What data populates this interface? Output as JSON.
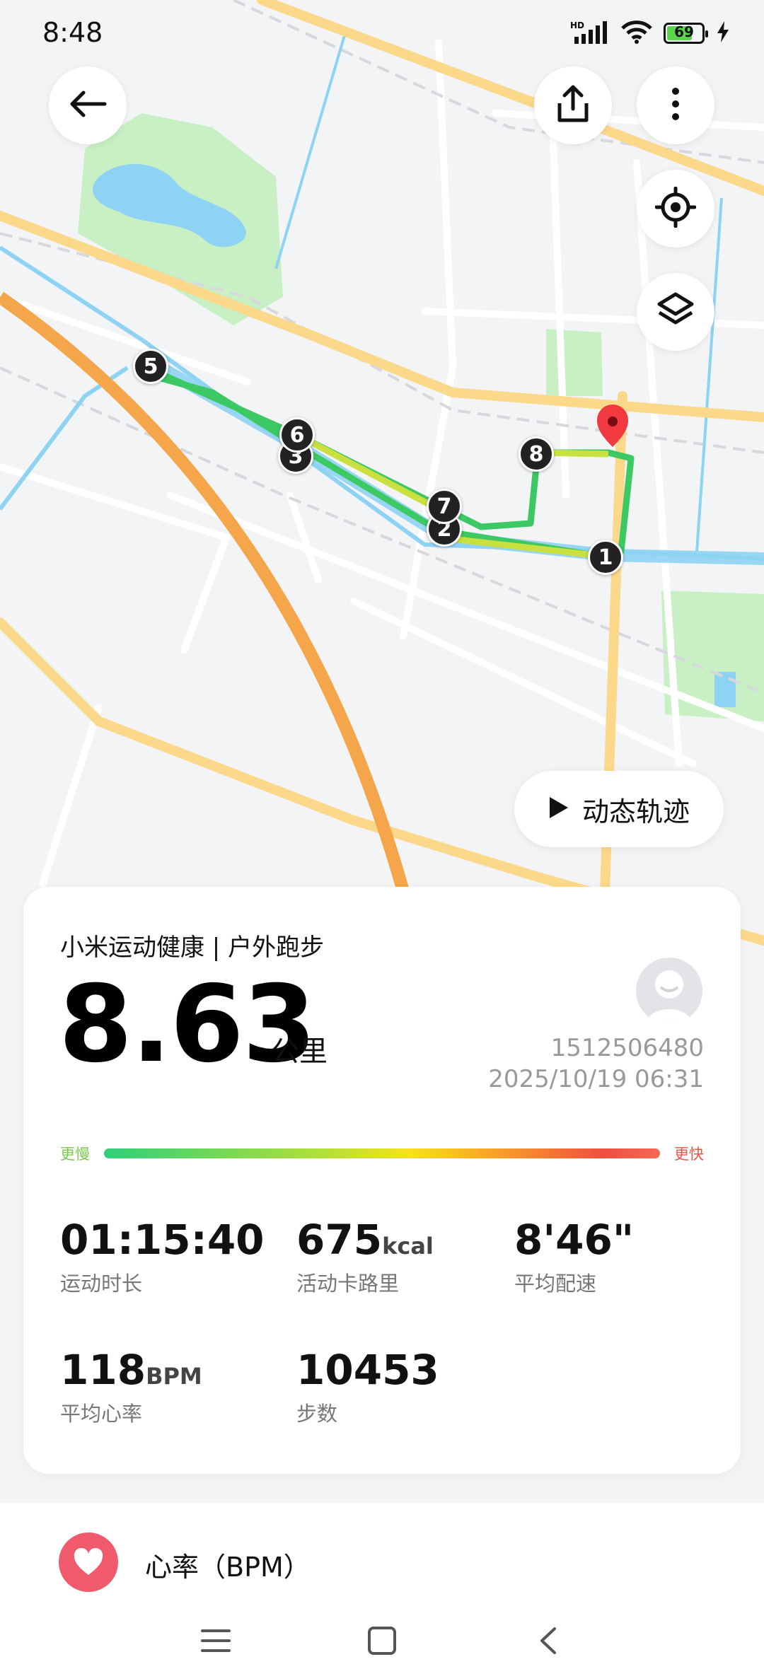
{
  "status_bar": {
    "time": "8:48",
    "battery": "69",
    "network": "HD"
  },
  "toolbar": {
    "back_icon": "arrow-left-icon",
    "share_icon": "share-icon",
    "more_icon": "more-vertical-icon",
    "locate_icon": "locate-icon",
    "layers_icon": "layers-icon"
  },
  "map": {
    "markers": [
      "1",
      "2",
      "3",
      "5",
      "6",
      "7",
      "8"
    ],
    "dynamic_track_label": "动态轨迹"
  },
  "summary": {
    "source": "小米运动健康 | 户外跑步",
    "distance": "8.63",
    "distance_unit": "公里",
    "user_id": "1512506480",
    "datetime": "2025/10/19 06:31",
    "pace_slow_label": "更慢",
    "pace_fast_label": "更快",
    "metrics": [
      {
        "value": "01:15:40",
        "unit": "",
        "label": "运动时长"
      },
      {
        "value": "675",
        "unit": "kcal",
        "label": "活动卡路里"
      },
      {
        "value": "8'46\"",
        "unit": "",
        "label": "平均配速"
      },
      {
        "value": "118",
        "unit": "BPM",
        "label": "平均心率"
      },
      {
        "value": "10453",
        "unit": "",
        "label": "步数"
      }
    ]
  },
  "heart_rate_section": {
    "label": "心率（BPM）"
  },
  "colors": {
    "route_green": "#3cc862",
    "route_yellow": "#c9e040",
    "river": "#8fd3f4",
    "park": "#c8f0c4",
    "road_major": "#fbd88a",
    "ring_road": "#f5a54a",
    "heart": "#f05a6d"
  }
}
